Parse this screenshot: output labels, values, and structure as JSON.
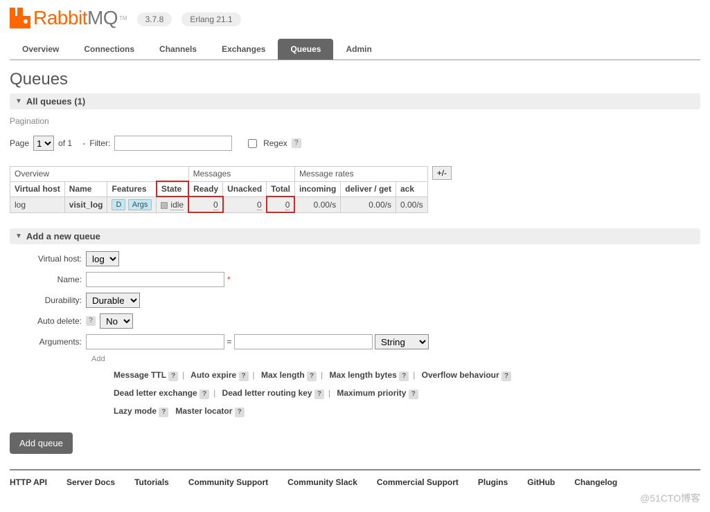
{
  "header": {
    "logo_text_a": "Rabbit",
    "logo_text_b": "MQ",
    "tm": "TM",
    "version": "3.7.8",
    "erlang": "Erlang 21.1"
  },
  "nav": {
    "tabs": [
      "Overview",
      "Connections",
      "Channels",
      "Exchanges",
      "Queues",
      "Admin"
    ],
    "active": 4
  },
  "page": {
    "title": "Queues",
    "section1": "All queues (1)",
    "pagination_label": "Pagination",
    "page_label": "Page",
    "page_value": "1",
    "of_label": "of 1",
    "filter_dash": "-",
    "filter_label": "Filter:",
    "regex_label": "Regex",
    "plusminus": "+/-"
  },
  "table": {
    "groups": [
      "Overview",
      "Messages",
      "Message rates"
    ],
    "cols": [
      "Virtual host",
      "Name",
      "Features",
      "State",
      "Ready",
      "Unacked",
      "Total",
      "incoming",
      "deliver / get",
      "ack"
    ],
    "row": {
      "vhost": "log",
      "name": "visit_log",
      "feat_d": "D",
      "feat_args": "Args",
      "state": "idle",
      "ready": "0",
      "unacked": "0",
      "total": "0",
      "incoming": "0.00/s",
      "deliver": "0.00/s",
      "ack": "0.00/s"
    }
  },
  "addq": {
    "title": "Add a new queue",
    "labels": {
      "vhost": "Virtual host:",
      "name": "Name:",
      "durability": "Durability:",
      "autodelete": "Auto delete:",
      "arguments": "Arguments:"
    },
    "vhost_value": "log",
    "durability_value": "Durable",
    "autodelete_value": "No",
    "argtype_value": "String",
    "eq": "=",
    "add_label": "Add",
    "hints1": [
      "Message TTL",
      "Auto expire",
      "Max length",
      "Max length bytes",
      "Overflow behaviour"
    ],
    "hints2": [
      "Dead letter exchange",
      "Dead letter routing key",
      "Maximum priority"
    ],
    "hints3": [
      "Lazy mode",
      "Master locator"
    ],
    "button": "Add queue"
  },
  "footer": {
    "links": [
      "HTTP API",
      "Server Docs",
      "Tutorials",
      "Community Support",
      "Community Slack",
      "Commercial Support",
      "Plugins",
      "GitHub",
      "Changelog"
    ],
    "watermark": "@51CTO博客"
  }
}
